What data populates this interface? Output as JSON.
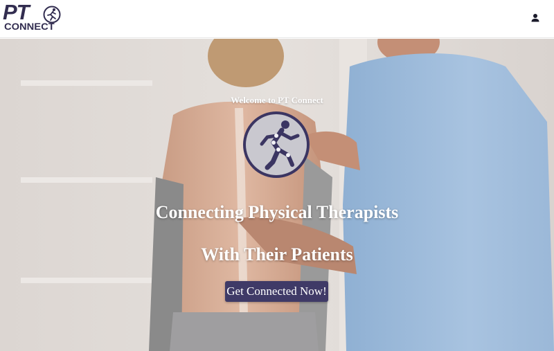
{
  "header": {
    "logo": {
      "text_top": "PT",
      "text_bottom": "CONNECT",
      "brand_color": "#322d50"
    },
    "account_icon": "user-icon"
  },
  "hero": {
    "welcome": "Welcome to PT Connect",
    "headline_line1": "Connecting Physical Therapists",
    "headline_line2": "With Their Patients",
    "cta_label": "Get Connected Now!",
    "cta_color": "#3f3a67",
    "emblem_icon": "running-figure-icon"
  }
}
